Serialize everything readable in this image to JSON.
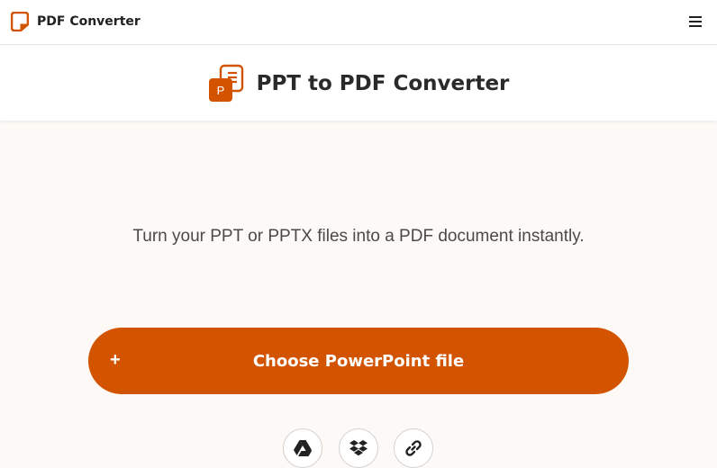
{
  "brand": {
    "name": "PDF Converter",
    "logo_icon": "pdf-converter-logo-icon"
  },
  "navbar": {
    "menu_icon": "hamburger-menu-icon"
  },
  "header": {
    "title": "PPT to PDF Converter",
    "icon": "powerpoint-file-icon",
    "icon_letter": "P"
  },
  "main": {
    "tagline": "Turn your PPT or PPTX files into a PDF document instantly.",
    "upload": {
      "plus": "+",
      "label": "Choose PowerPoint file"
    },
    "sources": [
      {
        "name": "google-drive",
        "icon": "google-drive-icon"
      },
      {
        "name": "dropbox",
        "icon": "dropbox-icon"
      },
      {
        "name": "url-link",
        "icon": "link-icon"
      }
    ]
  },
  "colors": {
    "accent": "#d35400",
    "background": "#fdf9f6",
    "header_bg": "#ffffff"
  }
}
